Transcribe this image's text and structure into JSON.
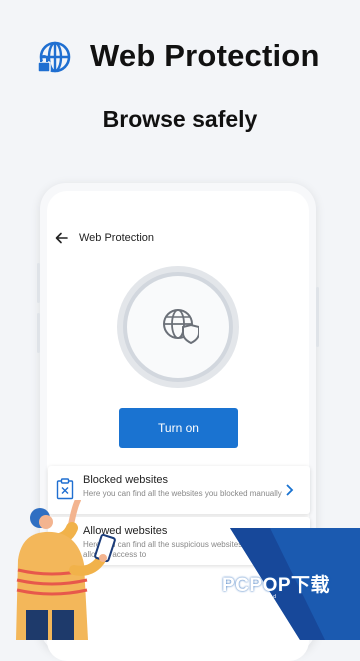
{
  "header": {
    "icon": "globe-lock-icon",
    "title": "Web Protection",
    "subtitle": "Browse safely"
  },
  "app": {
    "back_icon": "back-arrow-icon",
    "title": "Web Protection",
    "status_icon": "globe-shield-icon",
    "turn_on_label": "Turn on"
  },
  "lists": [
    {
      "title": "Blocked websites",
      "description": "Here you can find all the websites you blocked manually",
      "icon": "blocked-page-icon"
    },
    {
      "title": "Allowed websites",
      "description": "Here you can find all the suspicious websites you allowed access to"
    }
  ],
  "watermark": {
    "text": "PCPOP下载",
    "sub": "PCPOP Download"
  },
  "colors": {
    "accent": "#1a73d1",
    "icon_blue": "#1f6fd1",
    "background": "#f3f5f8"
  }
}
